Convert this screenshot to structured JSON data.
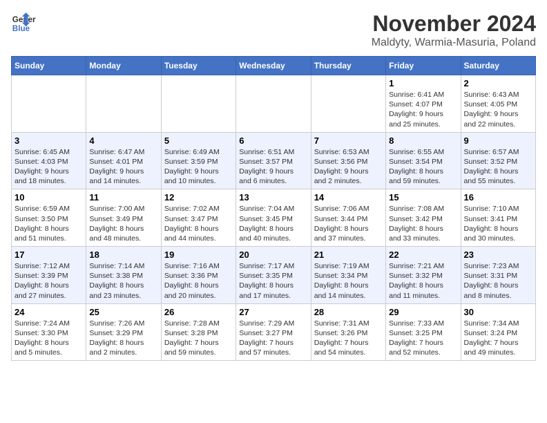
{
  "header": {
    "logo_line1": "General",
    "logo_line2": "Blue",
    "month_title": "November 2024",
    "location": "Maldyty, Warmia-Masuria, Poland"
  },
  "weekdays": [
    "Sunday",
    "Monday",
    "Tuesday",
    "Wednesday",
    "Thursday",
    "Friday",
    "Saturday"
  ],
  "weeks": [
    [
      {
        "day": "",
        "info": ""
      },
      {
        "day": "",
        "info": ""
      },
      {
        "day": "",
        "info": ""
      },
      {
        "day": "",
        "info": ""
      },
      {
        "day": "",
        "info": ""
      },
      {
        "day": "1",
        "info": "Sunrise: 6:41 AM\nSunset: 4:07 PM\nDaylight: 9 hours\nand 25 minutes."
      },
      {
        "day": "2",
        "info": "Sunrise: 6:43 AM\nSunset: 4:05 PM\nDaylight: 9 hours\nand 22 minutes."
      }
    ],
    [
      {
        "day": "3",
        "info": "Sunrise: 6:45 AM\nSunset: 4:03 PM\nDaylight: 9 hours\nand 18 minutes."
      },
      {
        "day": "4",
        "info": "Sunrise: 6:47 AM\nSunset: 4:01 PM\nDaylight: 9 hours\nand 14 minutes."
      },
      {
        "day": "5",
        "info": "Sunrise: 6:49 AM\nSunset: 3:59 PM\nDaylight: 9 hours\nand 10 minutes."
      },
      {
        "day": "6",
        "info": "Sunrise: 6:51 AM\nSunset: 3:57 PM\nDaylight: 9 hours\nand 6 minutes."
      },
      {
        "day": "7",
        "info": "Sunrise: 6:53 AM\nSunset: 3:56 PM\nDaylight: 9 hours\nand 2 minutes."
      },
      {
        "day": "8",
        "info": "Sunrise: 6:55 AM\nSunset: 3:54 PM\nDaylight: 8 hours\nand 59 minutes."
      },
      {
        "day": "9",
        "info": "Sunrise: 6:57 AM\nSunset: 3:52 PM\nDaylight: 8 hours\nand 55 minutes."
      }
    ],
    [
      {
        "day": "10",
        "info": "Sunrise: 6:59 AM\nSunset: 3:50 PM\nDaylight: 8 hours\nand 51 minutes."
      },
      {
        "day": "11",
        "info": "Sunrise: 7:00 AM\nSunset: 3:49 PM\nDaylight: 8 hours\nand 48 minutes."
      },
      {
        "day": "12",
        "info": "Sunrise: 7:02 AM\nSunset: 3:47 PM\nDaylight: 8 hours\nand 44 minutes."
      },
      {
        "day": "13",
        "info": "Sunrise: 7:04 AM\nSunset: 3:45 PM\nDaylight: 8 hours\nand 40 minutes."
      },
      {
        "day": "14",
        "info": "Sunrise: 7:06 AM\nSunset: 3:44 PM\nDaylight: 8 hours\nand 37 minutes."
      },
      {
        "day": "15",
        "info": "Sunrise: 7:08 AM\nSunset: 3:42 PM\nDaylight: 8 hours\nand 33 minutes."
      },
      {
        "day": "16",
        "info": "Sunrise: 7:10 AM\nSunset: 3:41 PM\nDaylight: 8 hours\nand 30 minutes."
      }
    ],
    [
      {
        "day": "17",
        "info": "Sunrise: 7:12 AM\nSunset: 3:39 PM\nDaylight: 8 hours\nand 27 minutes."
      },
      {
        "day": "18",
        "info": "Sunrise: 7:14 AM\nSunset: 3:38 PM\nDaylight: 8 hours\nand 23 minutes."
      },
      {
        "day": "19",
        "info": "Sunrise: 7:16 AM\nSunset: 3:36 PM\nDaylight: 8 hours\nand 20 minutes."
      },
      {
        "day": "20",
        "info": "Sunrise: 7:17 AM\nSunset: 3:35 PM\nDaylight: 8 hours\nand 17 minutes."
      },
      {
        "day": "21",
        "info": "Sunrise: 7:19 AM\nSunset: 3:34 PM\nDaylight: 8 hours\nand 14 minutes."
      },
      {
        "day": "22",
        "info": "Sunrise: 7:21 AM\nSunset: 3:32 PM\nDaylight: 8 hours\nand 11 minutes."
      },
      {
        "day": "23",
        "info": "Sunrise: 7:23 AM\nSunset: 3:31 PM\nDaylight: 8 hours\nand 8 minutes."
      }
    ],
    [
      {
        "day": "24",
        "info": "Sunrise: 7:24 AM\nSunset: 3:30 PM\nDaylight: 8 hours\nand 5 minutes."
      },
      {
        "day": "25",
        "info": "Sunrise: 7:26 AM\nSunset: 3:29 PM\nDaylight: 8 hours\nand 2 minutes."
      },
      {
        "day": "26",
        "info": "Sunrise: 7:28 AM\nSunset: 3:28 PM\nDaylight: 7 hours\nand 59 minutes."
      },
      {
        "day": "27",
        "info": "Sunrise: 7:29 AM\nSunset: 3:27 PM\nDaylight: 7 hours\nand 57 minutes."
      },
      {
        "day": "28",
        "info": "Sunrise: 7:31 AM\nSunset: 3:26 PM\nDaylight: 7 hours\nand 54 minutes."
      },
      {
        "day": "29",
        "info": "Sunrise: 7:33 AM\nSunset: 3:25 PM\nDaylight: 7 hours\nand 52 minutes."
      },
      {
        "day": "30",
        "info": "Sunrise: 7:34 AM\nSunset: 3:24 PM\nDaylight: 7 hours\nand 49 minutes."
      }
    ]
  ]
}
